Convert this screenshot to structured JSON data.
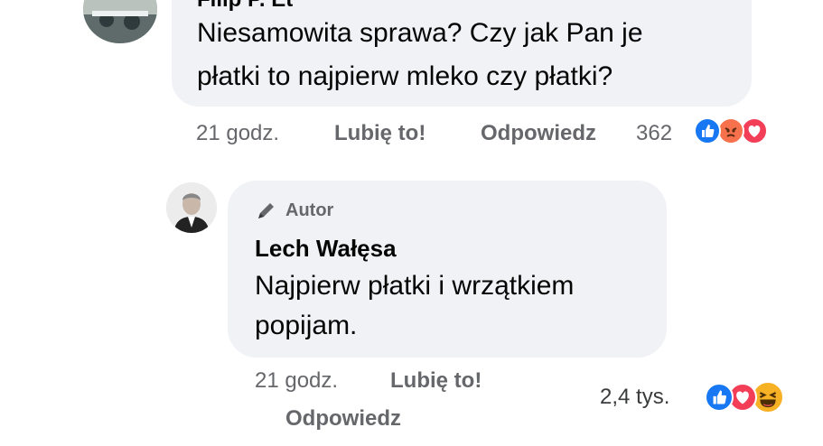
{
  "comment1": {
    "author_truncated": "Filip P. Et",
    "text_line1": "Niesamowita sprawa? Czy jak Pan je",
    "text_line2": "płatki to najpierw mleko czy płatki?",
    "time": "21 godz.",
    "like_label": "Lubię to!",
    "reply_label": "Odpowiedz",
    "reaction_count": "362",
    "reactions": [
      "like",
      "angry",
      "love"
    ]
  },
  "reply": {
    "badge_label": "Autor",
    "author": "Lech Wałęsa",
    "text_line1": "Najpierw płatki i wrzątkiem",
    "text_line2": "popijam.",
    "time": "21 godz.",
    "like_label": "Lubię to!",
    "reply_label": "Odpowiedz",
    "reaction_count": "2,4 tys.",
    "reactions": [
      "like",
      "love",
      "haha"
    ]
  },
  "colors": {
    "like": "#1877f2",
    "love": "#f33e58",
    "angry": "#f7714c",
    "haha": "#f7b125",
    "bubble": "#f0f2f5",
    "meta": "#65676b"
  }
}
